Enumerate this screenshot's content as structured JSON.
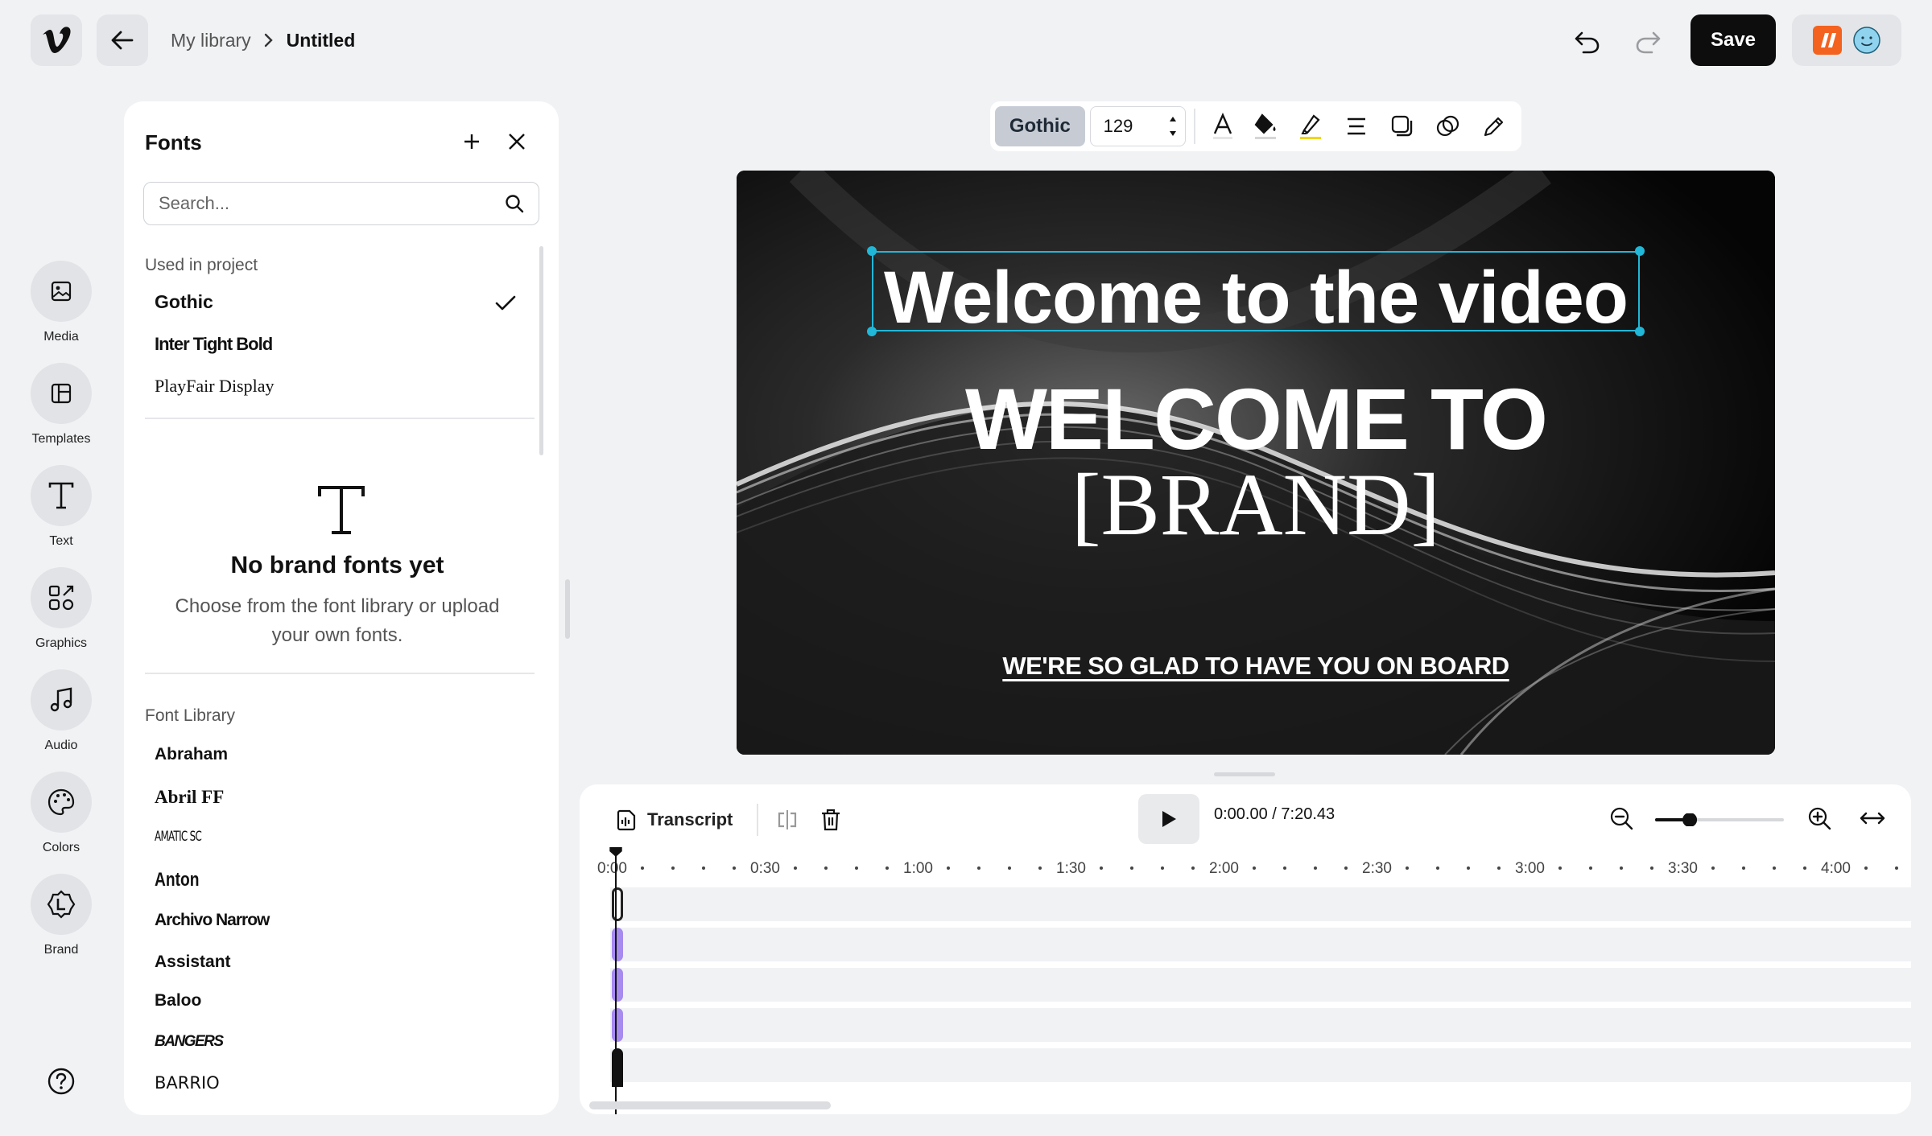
{
  "header": {
    "breadcrumb_library": "My library",
    "breadcrumb_current": "Untitled",
    "save_label": "Save"
  },
  "rail": {
    "items": [
      {
        "label": "Media",
        "icon": "image-icon"
      },
      {
        "label": "Templates",
        "icon": "template-icon"
      },
      {
        "label": "Text",
        "icon": "text-icon"
      },
      {
        "label": "Graphics",
        "icon": "shapes-icon"
      },
      {
        "label": "Audio",
        "icon": "music-icon"
      },
      {
        "label": "Colors",
        "icon": "palette-icon"
      },
      {
        "label": "Brand",
        "icon": "brand-icon"
      }
    ]
  },
  "fonts_panel": {
    "title": "Fonts",
    "search_placeholder": "Search...",
    "used_heading": "Used in project",
    "used_fonts": [
      "Gothic",
      "Inter Tight Bold",
      "PlayFair Display"
    ],
    "selected_font": "Gothic",
    "empty_title": "No brand fonts yet",
    "empty_text": "Choose from the font library or upload your own fonts.",
    "library_heading": "Font Library",
    "library_fonts": [
      "Abraham",
      "Abril FF",
      "AMATIC SC",
      "Anton",
      "Archivo Narrow",
      "Assistant",
      "Baloo",
      "BANGERS",
      "BARRIO"
    ]
  },
  "toolbar": {
    "font": "Gothic",
    "size": "129"
  },
  "canvas": {
    "line1": "Welcome to the video",
    "line2": "WELCOME TO",
    "line3": "[BRAND]",
    "line4": "WE'RE SO GLAD TO HAVE YOU ON BOARD"
  },
  "timeline": {
    "transcript_label": "Transcript",
    "current_time": "0:00.00",
    "total_time": "7:20.43",
    "time_separator": "/",
    "zoom_level": 0.24,
    "ruler_labels": [
      "0:00",
      "0:30",
      "1:00",
      "1:30",
      "2:00",
      "2:30",
      "3:00",
      "3:30",
      "4:00"
    ]
  },
  "colors": {
    "accent_selection": "#20b7d8",
    "clip_purple": "#a78bef",
    "save_bg": "#0d0d0d",
    "highlighter_yellow": "#f2d51b"
  }
}
